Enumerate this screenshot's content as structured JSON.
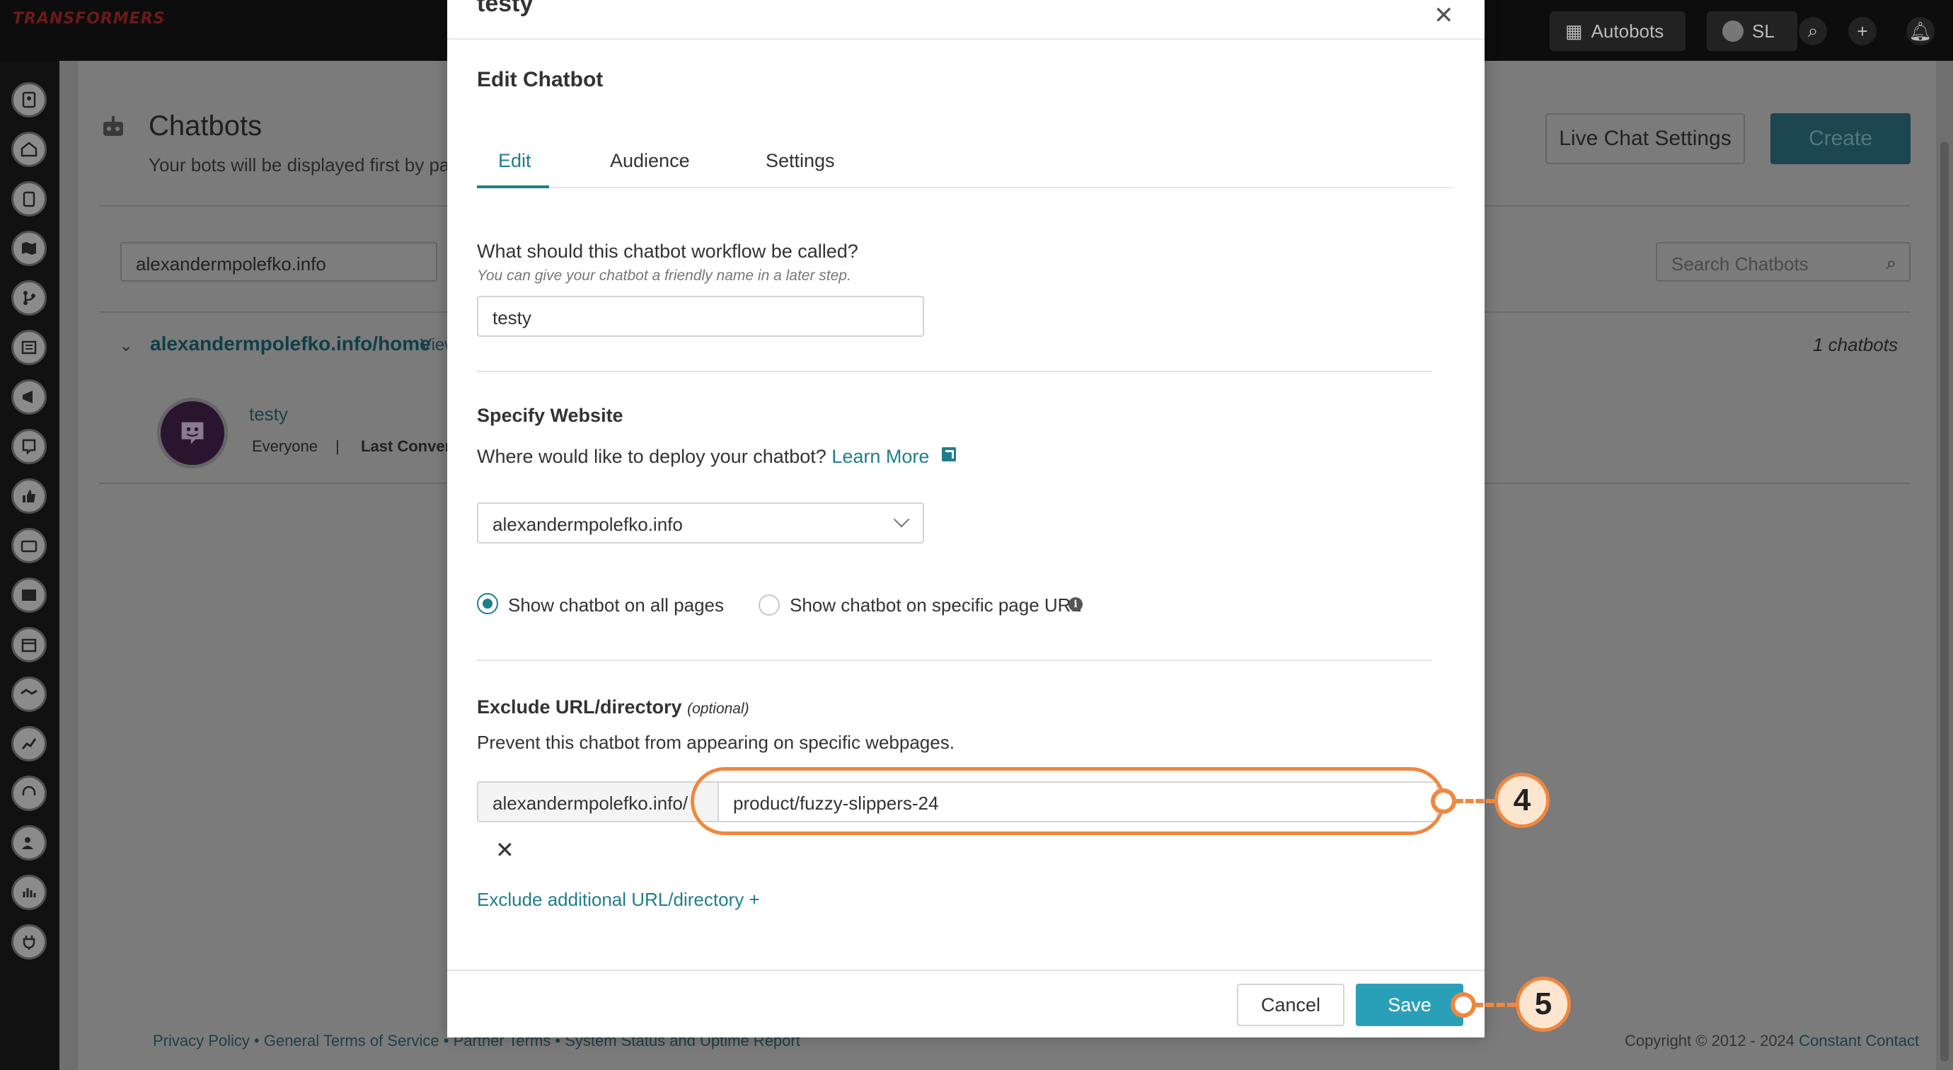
{
  "topbar": {
    "logo_text": "TRANSFORMERS",
    "workspace_label": "Autobots",
    "user_initials": "SL"
  },
  "background": {
    "page_title": "Chatbots",
    "page_subtitle": "Your bots will be displayed first by page",
    "site_select_value": "alexandermpolefko.info",
    "site_group_link": "alexandermpolefko.info/home",
    "site_group_view": "View",
    "chatbot_count": "1 chatbots",
    "bot_name": "testy",
    "bot_audience": "Everyone",
    "bot_separator": "|",
    "bot_last_conversation": "Last Convers",
    "live_chat_settings_label": "Live Chat Settings",
    "create_label": "Create",
    "search_placeholder": "Search Chatbots",
    "footer_links": "Privacy Policy • General Terms of Service • Partner Terms • System Status and Uptime Report",
    "copyright_prefix": "Copyright © 2012 - 2024",
    "copyright_brand": "Constant Contact"
  },
  "modal": {
    "top_title": "testy",
    "heading": "Edit Chatbot",
    "tabs": [
      {
        "label": "Edit",
        "active": true
      },
      {
        "label": "Audience",
        "active": false
      },
      {
        "label": "Settings",
        "active": false
      }
    ],
    "name_question": "What should this chatbot workflow be called?",
    "name_hint": "You can give your chatbot a friendly name in a later step.",
    "name_value": "testy",
    "specify_website_title": "Specify Website",
    "deploy_question": "Where would like to deploy your chatbot?",
    "learn_more_label": "Learn More",
    "website_select_value": "alexandermpolefko.info",
    "radio_all_pages": "Show chatbot on all pages",
    "radio_specific_page": "Show chatbot on specific page URL",
    "radio_selected": "all",
    "exclude_title": "Exclude URL/directory",
    "exclude_optional": "(optional)",
    "exclude_description": "Prevent this chatbot from appearing on specific webpages.",
    "exclude_prefix": "alexandermpolefko.info/",
    "exclude_value": "product/fuzzy-slippers-24",
    "remove_label": "✕",
    "add_exclude_label": "Exclude additional URL/directory +",
    "cancel_label": "Cancel",
    "save_label": "Save"
  },
  "annotations": {
    "step_input": "4",
    "step_save": "5"
  },
  "colors": {
    "accent": "#1e7e8c",
    "save_button": "#2aa0b8",
    "callout": "#f0873f",
    "callout_fill": "#fde6cf",
    "overlay": "#7b7b7b"
  },
  "icons": {
    "close": "close-icon",
    "dropdown": "chevron-down-icon",
    "external": "external-link-icon",
    "info": "info-icon",
    "remove": "remove-icon",
    "search": "search-icon",
    "add": "plus-icon",
    "settings": "gear-icon",
    "bot": "robot-icon"
  }
}
